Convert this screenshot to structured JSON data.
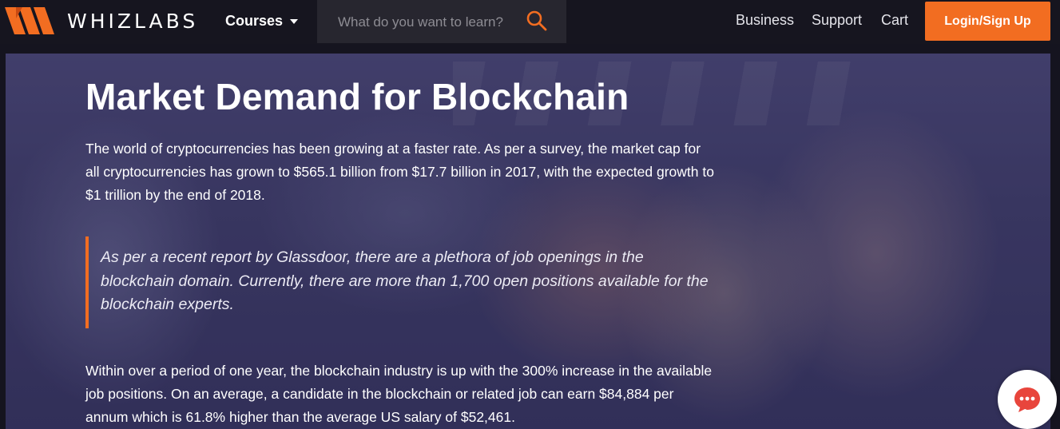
{
  "nav": {
    "logo_text": "WHIZLABS",
    "courses_label": "Courses",
    "search_placeholder": "What do you want to learn?",
    "links": [
      "Business",
      "Support",
      "Cart"
    ],
    "login_label": "Login/Sign Up"
  },
  "hero": {
    "title": "Market Demand for Blockchain",
    "paragraph1": "The world of cryptocurrencies has been growing at a faster rate. As per a survey, the market cap for all cryptocurrencies has grown to $565.1 billion from $17.7 billion in 2017, with the expected growth to $1 trillion by the end of 2018.",
    "quote": "As per a recent report by Glassdoor, there are a plethora of job openings in the blockchain domain. Currently, there are more than 1,700 open positions available for the blockchain experts.",
    "paragraph2": "Within over a period of one year, the blockchain industry is up with the 300% increase in the available job positions. On an average, a candidate in the blockchain or related job can earn $84,884 per annum which is 61.8% higher than the average US salary of $52,461."
  },
  "colors": {
    "accent": "#f26d21",
    "nav_bg": "#16151f",
    "chat_icon": "#e8453c"
  },
  "icons": [
    "logo-mark-icon",
    "caret-down-icon",
    "search-icon",
    "chat-icon"
  ]
}
